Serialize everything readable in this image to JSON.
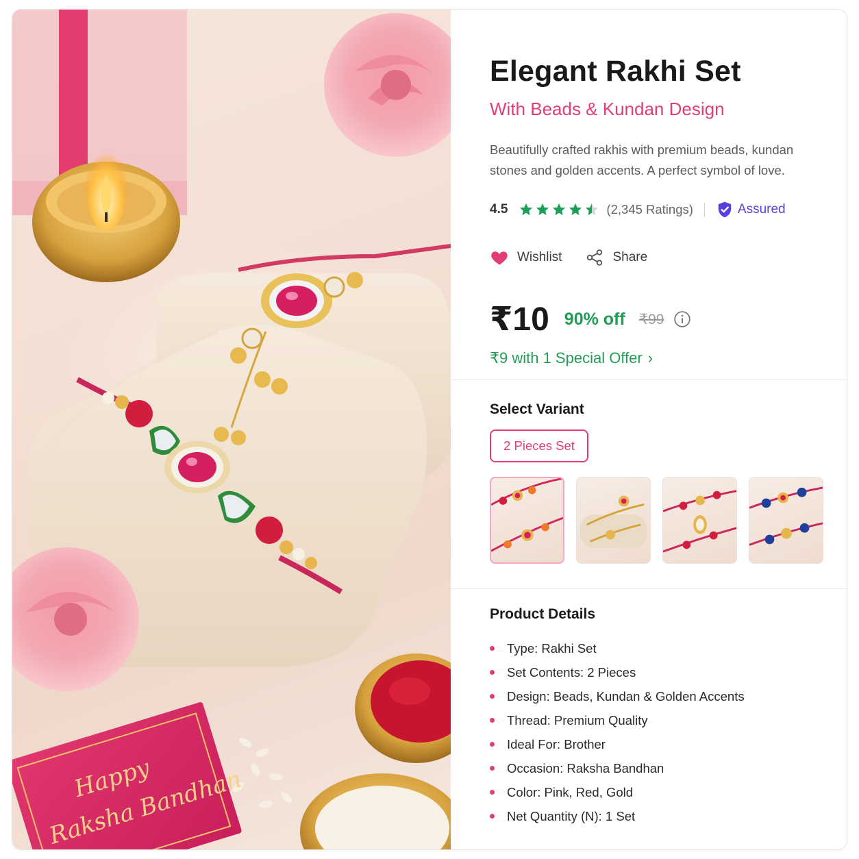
{
  "product": {
    "title": "Elegant Rakhi Set",
    "subtitle": "With Beads & Kundan Design",
    "description": "Beautifully crafted rakhis with premium beads, kundan stones and golden accents. A perfect symbol of love.",
    "image_card_text": [
      "Happy",
      "Raksha Bandhan"
    ]
  },
  "rating": {
    "value": "4.5",
    "stars": 4.5,
    "count_label": "(2,345 Ratings)",
    "assured_label": "Assured"
  },
  "actions": {
    "wishlist": "Wishlist",
    "share": "Share"
  },
  "pricing": {
    "price": "₹10",
    "discount": "90% off",
    "mrp": "₹99",
    "special_offer": "₹9 with 1 Special Offer"
  },
  "variants": {
    "heading": "Select Variant",
    "selected": "2 Pieces Set",
    "thumbnail_count": 4
  },
  "details": {
    "heading": "Product Details",
    "items": [
      "Type: Rakhi Set",
      "Set Contents: 2 Pieces",
      "Design: Beads, Kundan & Golden Accents",
      "Thread: Premium Quality",
      "Ideal For: Brother",
      "Occasion: Raksha Bandhan",
      "Color: Pink, Red, Gold",
      "Net Quantity (N): 1 Set"
    ]
  },
  "colors": {
    "accent_pink": "#e23d77",
    "discount_green": "#1f9d55",
    "assured_purple": "#5a3fe0",
    "star_green": "#1e9e57"
  }
}
